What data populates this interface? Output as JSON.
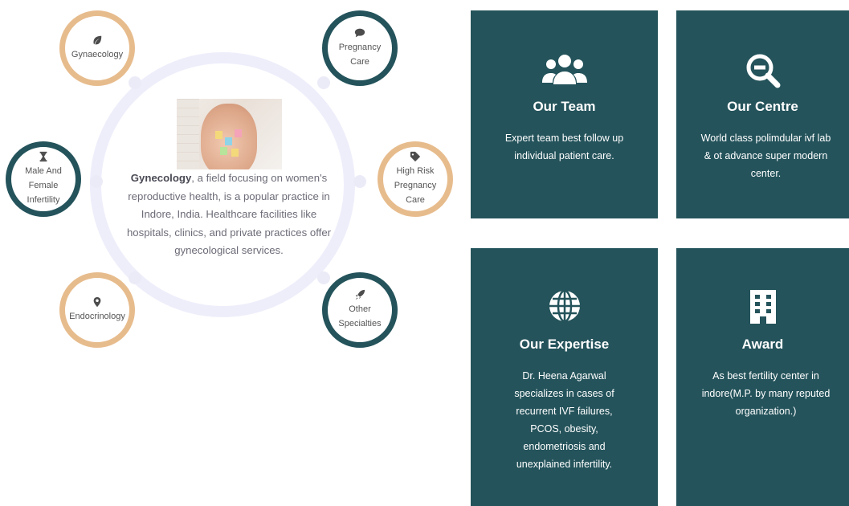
{
  "services_wheel": {
    "nodes": [
      {
        "key": "gynaecology",
        "label": "Gynaecology",
        "icon": "leaf-icon"
      },
      {
        "key": "pregnancy",
        "label": "Pregnancy Care",
        "icon": "speech-bubble-icon"
      },
      {
        "key": "infertility",
        "label": "Male And Female Infertility",
        "icon": "hourglass-icon"
      },
      {
        "key": "high-risk",
        "label": "High Risk Pregnancy Care",
        "icon": "tag-icon"
      },
      {
        "key": "endocrinology",
        "label": "Endocrinology",
        "icon": "map-pin-icon"
      },
      {
        "key": "other",
        "label": "Other Specialties",
        "icon": "rocket-icon"
      }
    ],
    "center": {
      "bold": "Gynecology",
      "text": ", a field focusing on women's reproductive health, is a popular practice in Indore, India. Healthcare facilities like hospitals, clinics, and private practices offer gynecological services."
    },
    "colors": {
      "tan": "#e7bc8d",
      "teal": "#24535b"
    }
  },
  "cards": [
    {
      "key": "team",
      "title": "Our Team",
      "text": "Expert team best follow up individual patient care.",
      "icon": "users-icon"
    },
    {
      "key": "centre",
      "title": "Our Centre",
      "text": "World class polimdular ivf lab & ot advance super modern center.",
      "icon": "search-minus-icon"
    },
    {
      "key": "expertise",
      "title": "Our Expertise",
      "text": "Dr. Heena Agarwal specializes in cases of recurrent IVF failures, PCOS, obesity, endometriosis and unexplained infertility.",
      "icon": "globe-icon"
    },
    {
      "key": "award",
      "title": "Award",
      "text": "As best fertility center in indore(M.P. by many reputed organization.)",
      "icon": "building-icon"
    }
  ],
  "card_color": "#24535b"
}
